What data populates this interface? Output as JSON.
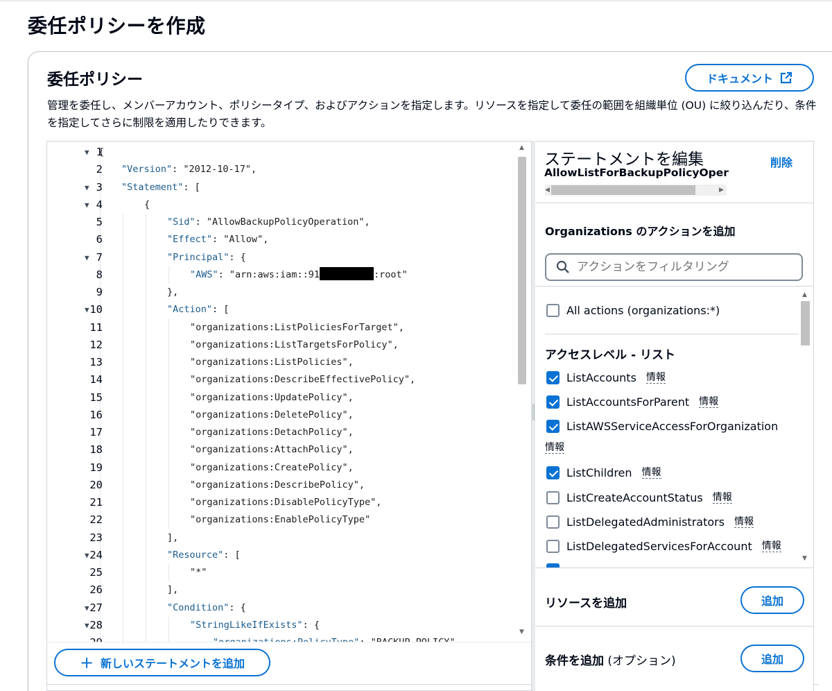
{
  "page": {
    "title": "委任ポリシーを作成"
  },
  "panel": {
    "title": "委任ポリシー",
    "doc_button": "ドキュメント",
    "description": "管理を委任し、メンバーアカウント、ポリシータイプ、およびアクションを指定します。リソースを指定して委任の範囲を組織単位 (OU) に絞り込んだり、条件を指定してさらに制限を適用したりできます。"
  },
  "editor": {
    "add_statement_button": "新しいステートメントを追加",
    "lines": [
      {
        "n": "1",
        "fold": true,
        "indent": 0,
        "parts": [
          [
            "p",
            "{"
          ]
        ]
      },
      {
        "n": "2",
        "fold": false,
        "indent": 1,
        "parts": [
          [
            "k",
            "\"Version\""
          ],
          [
            "p",
            ": "
          ],
          [
            "s",
            "\"2012-10-17\""
          ],
          [
            "p",
            ","
          ]
        ]
      },
      {
        "n": "3",
        "fold": true,
        "indent": 1,
        "parts": [
          [
            "k",
            "\"Statement\""
          ],
          [
            "p",
            ": ["
          ]
        ]
      },
      {
        "n": "4",
        "fold": true,
        "indent": 2,
        "parts": [
          [
            "p",
            "{"
          ]
        ]
      },
      {
        "n": "5",
        "fold": false,
        "indent": 3,
        "parts": [
          [
            "k",
            "\"Sid\""
          ],
          [
            "p",
            ": "
          ],
          [
            "s",
            "\"AllowBackupPolicyOperation\""
          ],
          [
            "p",
            ","
          ]
        ]
      },
      {
        "n": "6",
        "fold": false,
        "indent": 3,
        "parts": [
          [
            "k",
            "\"Effect\""
          ],
          [
            "p",
            ": "
          ],
          [
            "s",
            "\"Allow\""
          ],
          [
            "p",
            ","
          ]
        ]
      },
      {
        "n": "7",
        "fold": true,
        "indent": 3,
        "parts": [
          [
            "k",
            "\"Principal\""
          ],
          [
            "p",
            ": {"
          ]
        ]
      },
      {
        "n": "8",
        "fold": false,
        "indent": 4,
        "parts": [
          [
            "k",
            "\"AWS\""
          ],
          [
            "p",
            ": "
          ],
          [
            "s",
            "\"arn:aws:iam::91"
          ],
          [
            "r",
            ""
          ],
          [
            "s",
            ":root\""
          ]
        ]
      },
      {
        "n": "9",
        "fold": false,
        "indent": 3,
        "parts": [
          [
            "p",
            "},"
          ]
        ]
      },
      {
        "n": "10",
        "fold": true,
        "indent": 3,
        "parts": [
          [
            "k",
            "\"Action\""
          ],
          [
            "p",
            ": ["
          ]
        ]
      },
      {
        "n": "11",
        "fold": false,
        "indent": 4,
        "parts": [
          [
            "s",
            "\"organizations:ListPoliciesForTarget\""
          ],
          [
            "p",
            ","
          ]
        ]
      },
      {
        "n": "12",
        "fold": false,
        "indent": 4,
        "parts": [
          [
            "s",
            "\"organizations:ListTargetsForPolicy\""
          ],
          [
            "p",
            ","
          ]
        ]
      },
      {
        "n": "13",
        "fold": false,
        "indent": 4,
        "parts": [
          [
            "s",
            "\"organizations:ListPolicies\""
          ],
          [
            "p",
            ","
          ]
        ]
      },
      {
        "n": "14",
        "fold": false,
        "indent": 4,
        "parts": [
          [
            "s",
            "\"organizations:DescribeEffectivePolicy\""
          ],
          [
            "p",
            ","
          ]
        ]
      },
      {
        "n": "15",
        "fold": false,
        "indent": 4,
        "parts": [
          [
            "s",
            "\"organizations:UpdatePolicy\""
          ],
          [
            "p",
            ","
          ]
        ]
      },
      {
        "n": "16",
        "fold": false,
        "indent": 4,
        "parts": [
          [
            "s",
            "\"organizations:DeletePolicy\""
          ],
          [
            "p",
            ","
          ]
        ]
      },
      {
        "n": "17",
        "fold": false,
        "indent": 4,
        "parts": [
          [
            "s",
            "\"organizations:DetachPolicy\""
          ],
          [
            "p",
            ","
          ]
        ]
      },
      {
        "n": "18",
        "fold": false,
        "indent": 4,
        "parts": [
          [
            "s",
            "\"organizations:AttachPolicy\""
          ],
          [
            "p",
            ","
          ]
        ]
      },
      {
        "n": "19",
        "fold": false,
        "indent": 4,
        "parts": [
          [
            "s",
            "\"organizations:CreatePolicy\""
          ],
          [
            "p",
            ","
          ]
        ]
      },
      {
        "n": "20",
        "fold": false,
        "indent": 4,
        "parts": [
          [
            "s",
            "\"organizations:DescribePolicy\""
          ],
          [
            "p",
            ","
          ]
        ]
      },
      {
        "n": "21",
        "fold": false,
        "indent": 4,
        "parts": [
          [
            "s",
            "\"organizations:DisablePolicyType\""
          ],
          [
            "p",
            ","
          ]
        ]
      },
      {
        "n": "22",
        "fold": false,
        "indent": 4,
        "parts": [
          [
            "s",
            "\"organizations:EnablePolicyType\""
          ]
        ]
      },
      {
        "n": "23",
        "fold": false,
        "indent": 3,
        "parts": [
          [
            "p",
            "],"
          ]
        ]
      },
      {
        "n": "24",
        "fold": true,
        "indent": 3,
        "parts": [
          [
            "k",
            "\"Resource\""
          ],
          [
            "p",
            ": ["
          ]
        ]
      },
      {
        "n": "25",
        "fold": false,
        "indent": 4,
        "parts": [
          [
            "s",
            "\"*\""
          ]
        ]
      },
      {
        "n": "26",
        "fold": false,
        "indent": 3,
        "parts": [
          [
            "p",
            "],"
          ]
        ]
      },
      {
        "n": "27",
        "fold": true,
        "indent": 3,
        "parts": [
          [
            "k",
            "\"Condition\""
          ],
          [
            "p",
            ": {"
          ]
        ]
      },
      {
        "n": "28",
        "fold": true,
        "indent": 4,
        "parts": [
          [
            "k",
            "\"StringLikeIfExists\""
          ],
          [
            "p",
            ": {"
          ]
        ]
      },
      {
        "n": "29",
        "fold": false,
        "indent": 5,
        "parts": [
          [
            "k",
            "\"organizations:PolicyType\""
          ],
          [
            "p",
            ": "
          ],
          [
            "s",
            "\"BACKUP_POLICY\""
          ]
        ]
      }
    ]
  },
  "statement_editor": {
    "title": "ステートメントを編集",
    "delete_label": "削除",
    "sid": "AllowListForBackupPolicyOpera",
    "actions_heading": "Organizations のアクションを追加",
    "filter_placeholder": "アクションをフィルタリング",
    "all_actions_label": "All actions (organizations:*)",
    "access_level_heading": "アクセスレベル - リスト",
    "info_label": "情報",
    "actions": [
      {
        "label": "ListAccounts",
        "checked": true
      },
      {
        "label": "ListAccountsForParent",
        "checked": true
      },
      {
        "label": "ListAWSServiceAccessForOrganization",
        "checked": true
      },
      {
        "label": "ListChildren",
        "checked": true
      },
      {
        "label": "ListCreateAccountStatus",
        "checked": false
      },
      {
        "label": "ListDelegatedAdministrators",
        "checked": false
      },
      {
        "label": "ListDelegatedServicesForAccount",
        "checked": false
      }
    ],
    "resource_heading": "リソースを追加",
    "resource_add_button": "追加",
    "condition_heading": "条件を追加",
    "condition_optional": "(オプション)",
    "condition_add_button": "追加"
  },
  "colors": {
    "accent": "#0972d3",
    "text": "#000716",
    "border": "#d1d5db"
  }
}
